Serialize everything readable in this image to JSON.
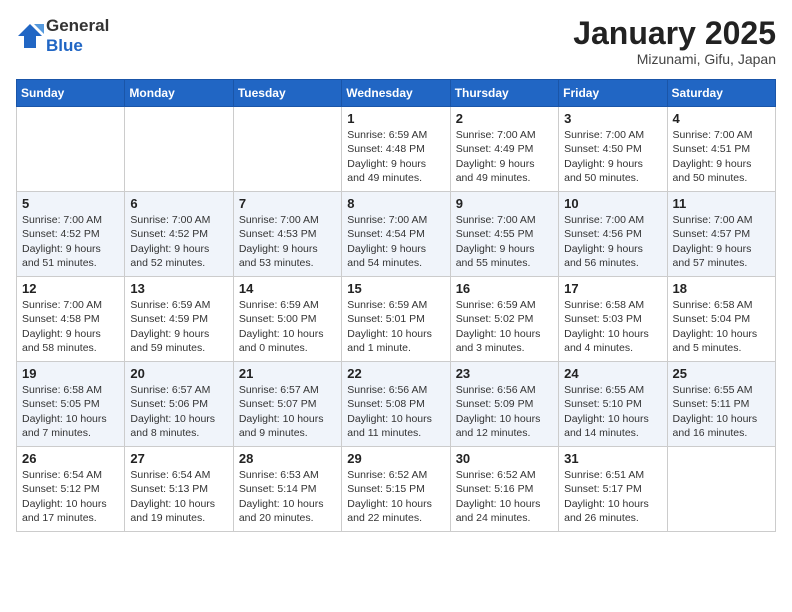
{
  "logo": {
    "general": "General",
    "blue": "Blue"
  },
  "title": "January 2025",
  "subtitle": "Mizunami, Gifu, Japan",
  "weekdays": [
    "Sunday",
    "Monday",
    "Tuesday",
    "Wednesday",
    "Thursday",
    "Friday",
    "Saturday"
  ],
  "weeks": [
    [
      {
        "day": "",
        "detail": ""
      },
      {
        "day": "",
        "detail": ""
      },
      {
        "day": "",
        "detail": ""
      },
      {
        "day": "1",
        "detail": "Sunrise: 6:59 AM\nSunset: 4:48 PM\nDaylight: 9 hours\nand 49 minutes."
      },
      {
        "day": "2",
        "detail": "Sunrise: 7:00 AM\nSunset: 4:49 PM\nDaylight: 9 hours\nand 49 minutes."
      },
      {
        "day": "3",
        "detail": "Sunrise: 7:00 AM\nSunset: 4:50 PM\nDaylight: 9 hours\nand 50 minutes."
      },
      {
        "day": "4",
        "detail": "Sunrise: 7:00 AM\nSunset: 4:51 PM\nDaylight: 9 hours\nand 50 minutes."
      }
    ],
    [
      {
        "day": "5",
        "detail": "Sunrise: 7:00 AM\nSunset: 4:52 PM\nDaylight: 9 hours\nand 51 minutes."
      },
      {
        "day": "6",
        "detail": "Sunrise: 7:00 AM\nSunset: 4:52 PM\nDaylight: 9 hours\nand 52 minutes."
      },
      {
        "day": "7",
        "detail": "Sunrise: 7:00 AM\nSunset: 4:53 PM\nDaylight: 9 hours\nand 53 minutes."
      },
      {
        "day": "8",
        "detail": "Sunrise: 7:00 AM\nSunset: 4:54 PM\nDaylight: 9 hours\nand 54 minutes."
      },
      {
        "day": "9",
        "detail": "Sunrise: 7:00 AM\nSunset: 4:55 PM\nDaylight: 9 hours\nand 55 minutes."
      },
      {
        "day": "10",
        "detail": "Sunrise: 7:00 AM\nSunset: 4:56 PM\nDaylight: 9 hours\nand 56 minutes."
      },
      {
        "day": "11",
        "detail": "Sunrise: 7:00 AM\nSunset: 4:57 PM\nDaylight: 9 hours\nand 57 minutes."
      }
    ],
    [
      {
        "day": "12",
        "detail": "Sunrise: 7:00 AM\nSunset: 4:58 PM\nDaylight: 9 hours\nand 58 minutes."
      },
      {
        "day": "13",
        "detail": "Sunrise: 6:59 AM\nSunset: 4:59 PM\nDaylight: 9 hours\nand 59 minutes."
      },
      {
        "day": "14",
        "detail": "Sunrise: 6:59 AM\nSunset: 5:00 PM\nDaylight: 10 hours\nand 0 minutes."
      },
      {
        "day": "15",
        "detail": "Sunrise: 6:59 AM\nSunset: 5:01 PM\nDaylight: 10 hours\nand 1 minute."
      },
      {
        "day": "16",
        "detail": "Sunrise: 6:59 AM\nSunset: 5:02 PM\nDaylight: 10 hours\nand 3 minutes."
      },
      {
        "day": "17",
        "detail": "Sunrise: 6:58 AM\nSunset: 5:03 PM\nDaylight: 10 hours\nand 4 minutes."
      },
      {
        "day": "18",
        "detail": "Sunrise: 6:58 AM\nSunset: 5:04 PM\nDaylight: 10 hours\nand 5 minutes."
      }
    ],
    [
      {
        "day": "19",
        "detail": "Sunrise: 6:58 AM\nSunset: 5:05 PM\nDaylight: 10 hours\nand 7 minutes."
      },
      {
        "day": "20",
        "detail": "Sunrise: 6:57 AM\nSunset: 5:06 PM\nDaylight: 10 hours\nand 8 minutes."
      },
      {
        "day": "21",
        "detail": "Sunrise: 6:57 AM\nSunset: 5:07 PM\nDaylight: 10 hours\nand 9 minutes."
      },
      {
        "day": "22",
        "detail": "Sunrise: 6:56 AM\nSunset: 5:08 PM\nDaylight: 10 hours\nand 11 minutes."
      },
      {
        "day": "23",
        "detail": "Sunrise: 6:56 AM\nSunset: 5:09 PM\nDaylight: 10 hours\nand 12 minutes."
      },
      {
        "day": "24",
        "detail": "Sunrise: 6:55 AM\nSunset: 5:10 PM\nDaylight: 10 hours\nand 14 minutes."
      },
      {
        "day": "25",
        "detail": "Sunrise: 6:55 AM\nSunset: 5:11 PM\nDaylight: 10 hours\nand 16 minutes."
      }
    ],
    [
      {
        "day": "26",
        "detail": "Sunrise: 6:54 AM\nSunset: 5:12 PM\nDaylight: 10 hours\nand 17 minutes."
      },
      {
        "day": "27",
        "detail": "Sunrise: 6:54 AM\nSunset: 5:13 PM\nDaylight: 10 hours\nand 19 minutes."
      },
      {
        "day": "28",
        "detail": "Sunrise: 6:53 AM\nSunset: 5:14 PM\nDaylight: 10 hours\nand 20 minutes."
      },
      {
        "day": "29",
        "detail": "Sunrise: 6:52 AM\nSunset: 5:15 PM\nDaylight: 10 hours\nand 22 minutes."
      },
      {
        "day": "30",
        "detail": "Sunrise: 6:52 AM\nSunset: 5:16 PM\nDaylight: 10 hours\nand 24 minutes."
      },
      {
        "day": "31",
        "detail": "Sunrise: 6:51 AM\nSunset: 5:17 PM\nDaylight: 10 hours\nand 26 minutes."
      },
      {
        "day": "",
        "detail": ""
      }
    ]
  ]
}
